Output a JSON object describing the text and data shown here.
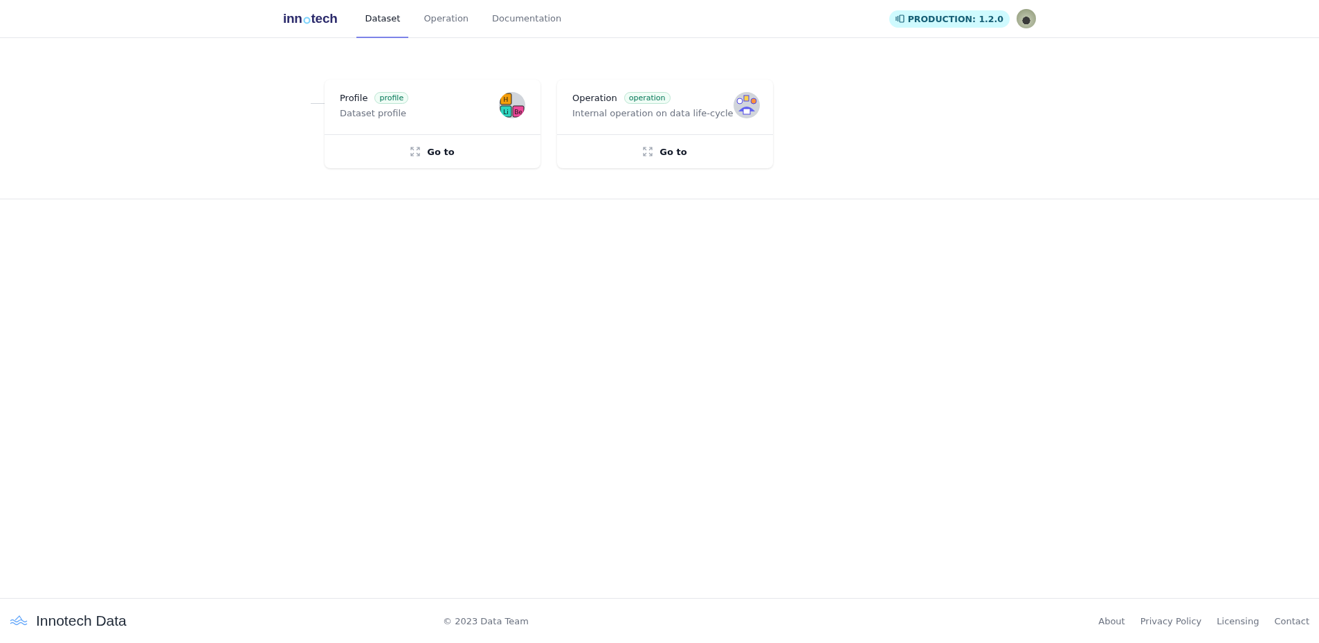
{
  "header": {
    "logo": {
      "before": "inn",
      "after": "tech"
    },
    "tabs": [
      {
        "label": "Dataset",
        "selected": true
      },
      {
        "label": "Operation",
        "selected": false
      },
      {
        "label": "Documentation",
        "selected": false
      }
    ],
    "environment_badge": "PRODUCTION: 1.2.0"
  },
  "cards": [
    {
      "kind": "elements",
      "title": "Profile",
      "tag": "profile",
      "description": "Dataset profile",
      "tiles": [
        "H",
        "Li",
        "Be"
      ],
      "action": "Go to"
    },
    {
      "kind": "network",
      "title": "Operation",
      "tag": "operation",
      "description": "Internal operation on data life-cycle",
      "action": "Go to"
    }
  ],
  "footer": {
    "brand": "Innotech Data",
    "copyright": "© 2023 Data Team",
    "links": [
      "About",
      "Privacy Policy",
      "Licensing",
      "Contact"
    ]
  }
}
